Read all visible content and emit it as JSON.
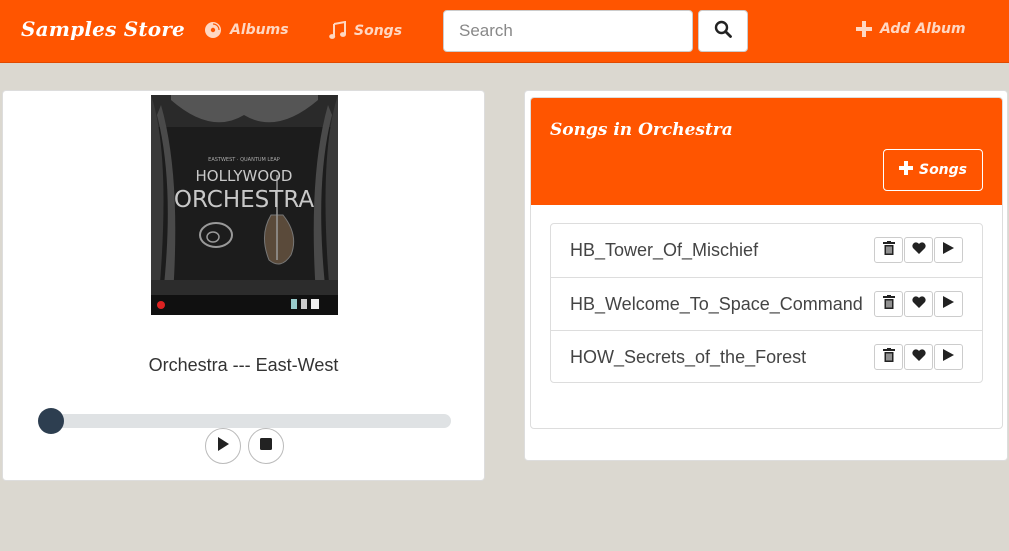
{
  "navbar": {
    "brand": "Samples Store",
    "links": [
      {
        "label": "Albums",
        "icon": "disc-icon"
      },
      {
        "label": "Songs",
        "icon": "music-note-icon"
      }
    ],
    "search": {
      "placeholder": "Search",
      "value": "",
      "button_icon": "search-icon"
    },
    "add_album": {
      "label": "Add Album",
      "icon": "plus-icon"
    }
  },
  "album": {
    "cover_alt": "Hollywood Orchestra album cover",
    "cover_text": {
      "top": "EASTWEST · QUANTUM LEAP",
      "line1": "HOLLYWOOD",
      "line2": "ORCHESTRA"
    },
    "title": "Orchestra --- East-West",
    "player": {
      "progress": 0,
      "play_icon": "play-icon",
      "stop_icon": "stop-icon"
    }
  },
  "songs_panel": {
    "title": "Songs in Orchestra",
    "add_button_label": "Songs",
    "songs": [
      {
        "name": "HB_Tower_Of_Mischief"
      },
      {
        "name": "HB_Welcome_To_Space_Command"
      },
      {
        "name": "HOW_Secrets_of_the_Forest"
      }
    ]
  },
  "colors": {
    "accent": "#ff5500",
    "background": "#dbd8d0",
    "knob": "#2d3e50"
  }
}
